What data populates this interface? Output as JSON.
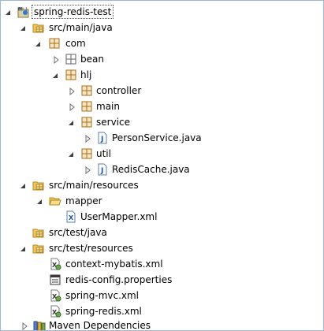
{
  "tree": [
    {
      "label": "spring-redis-test",
      "icon": "maven-project-icon",
      "twisty": "expanded"
    },
    {
      "label": "src/main/java",
      "icon": "source-folder-icon",
      "twisty": "expanded"
    },
    {
      "label": "com",
      "icon": "package-icon",
      "twisty": "expanded"
    },
    {
      "label": "bean",
      "icon": "empty-package-icon",
      "twisty": "collapsed"
    },
    {
      "label": "hlj",
      "icon": "package-icon",
      "twisty": "expanded"
    },
    {
      "label": "controller",
      "icon": "package-icon",
      "twisty": "collapsed"
    },
    {
      "label": "main",
      "icon": "package-icon",
      "twisty": "collapsed"
    },
    {
      "label": "service",
      "icon": "package-icon",
      "twisty": "expanded"
    },
    {
      "label": "PersonService.java",
      "icon": "java-file-icon",
      "twisty": "collapsed"
    },
    {
      "label": "util",
      "icon": "package-icon",
      "twisty": "expanded"
    },
    {
      "label": "RedisCache.java",
      "icon": "java-file-icon",
      "twisty": "collapsed"
    },
    {
      "label": "src/main/resources",
      "icon": "source-folder-icon",
      "twisty": "expanded"
    },
    {
      "label": "mapper",
      "icon": "folder-open-icon",
      "twisty": "expanded"
    },
    {
      "label": "UserMapper.xml",
      "icon": "xml-file-icon",
      "twisty": "none"
    },
    {
      "label": "src/test/java",
      "icon": "source-folder-icon",
      "twisty": "none"
    },
    {
      "label": "src/test/resources",
      "icon": "source-folder-icon",
      "twisty": "expanded"
    },
    {
      "label": "context-mybatis.xml",
      "icon": "xml-config-icon",
      "twisty": "none"
    },
    {
      "label": "redis-config.properties",
      "icon": "properties-file-icon",
      "twisty": "none"
    },
    {
      "label": "spring-mvc.xml",
      "icon": "xml-config-icon",
      "twisty": "none"
    },
    {
      "label": "spring-redis.xml",
      "icon": "xml-config-icon",
      "twisty": "none"
    },
    {
      "label": "Maven Dependencies",
      "icon": "library-icon",
      "twisty": "collapsed"
    }
  ]
}
